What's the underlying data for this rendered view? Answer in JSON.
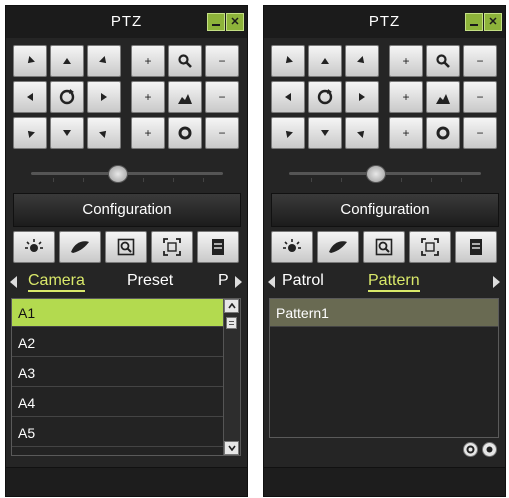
{
  "left_panel": {
    "title": "PTZ",
    "configuration_label": "Configuration",
    "tabs": [
      "Camera",
      "Preset",
      "P"
    ],
    "active_tab": "Camera",
    "list": [
      "A1",
      "A2",
      "A3",
      "A4",
      "A5"
    ],
    "selected_item": "A1"
  },
  "right_panel": {
    "title": "PTZ",
    "configuration_label": "Configuration",
    "tabs": [
      "Patrol",
      "Pattern"
    ],
    "active_tab": "Pattern",
    "list": [
      "Pattern1"
    ],
    "selected_item": "Pattern1"
  },
  "ptz_controls": {
    "direction_icons": [
      "arrow-up-left",
      "arrow-up",
      "arrow-up-right",
      "arrow-left",
      "auto-rotate",
      "arrow-right",
      "arrow-down-left",
      "arrow-down",
      "arrow-down-right"
    ],
    "zoom": {
      "plus": "+",
      "minus": "−",
      "icon": "zoom-icon"
    },
    "focus": {
      "plus": "+",
      "minus": "−",
      "icon": "focus-icon"
    },
    "iris": {
      "plus": "+",
      "minus": "−",
      "icon": "iris-icon"
    },
    "speed_slider_level": 0.45
  },
  "toolbar_icons": [
    "light-icon",
    "wiper-icon",
    "3d-zoom-icon",
    "center-icon",
    "menu-icon"
  ],
  "colors": {
    "accent": "#d9e86a",
    "selected_row": "#b3da4f",
    "panel_bg": "#252525",
    "window_buttons": "#8db33a"
  }
}
